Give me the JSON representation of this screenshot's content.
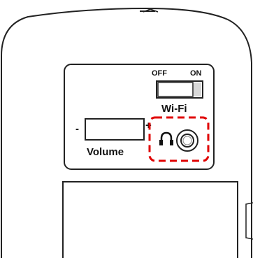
{
  "device": {
    "wifi_switch": {
      "off_label": "OFF",
      "on_label": "ON",
      "caption": "Wi-Fi",
      "state": "OFF"
    },
    "volume": {
      "minus_label": "-",
      "plus_label": "+",
      "caption": "Volume"
    },
    "headphone": {
      "icon": "headphone-icon",
      "jack_icon": "audio-jack-icon",
      "highlight_color": "#e00000"
    }
  }
}
